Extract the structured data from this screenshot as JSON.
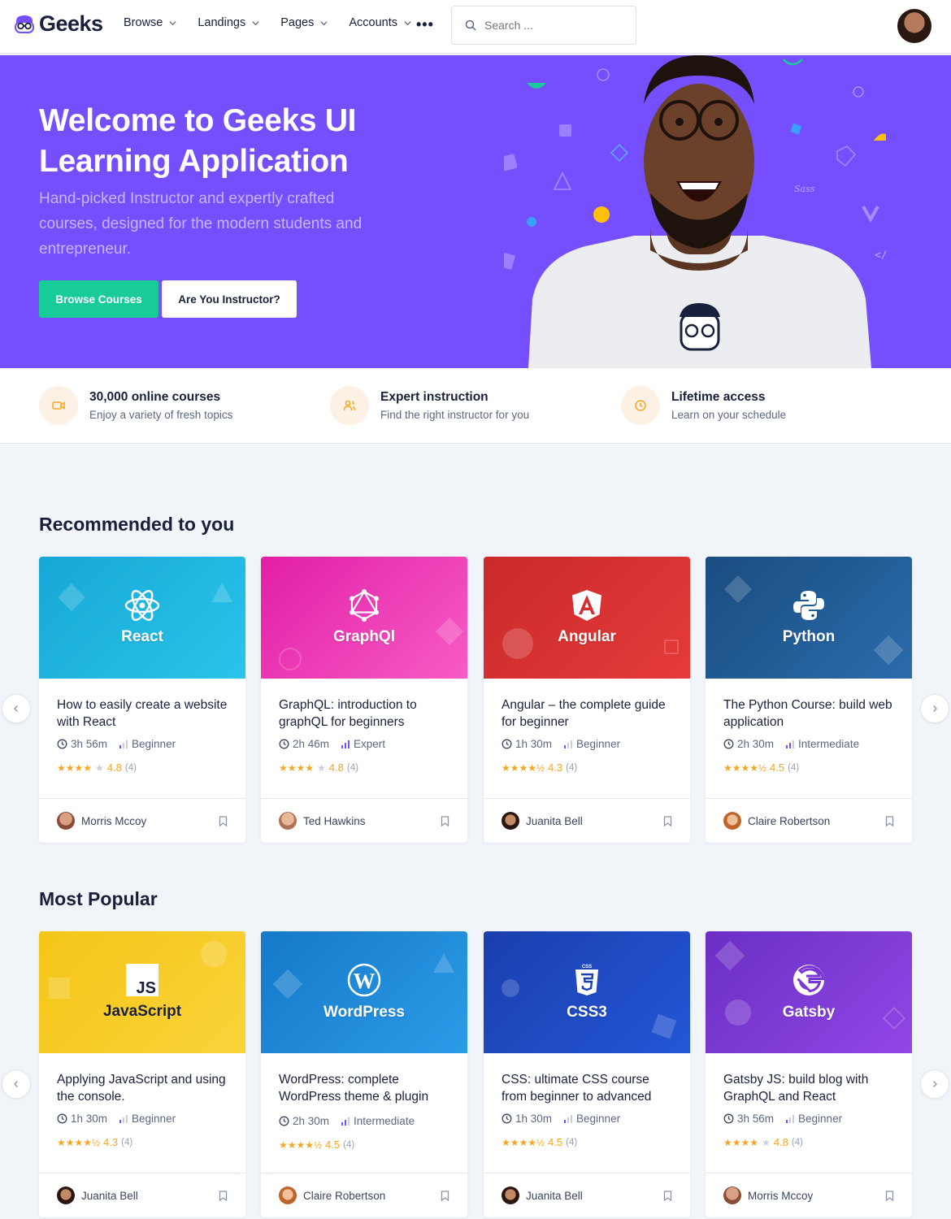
{
  "brand": {
    "name": "Geeks"
  },
  "nav": {
    "items": [
      {
        "label": "Browse"
      },
      {
        "label": "Landings"
      },
      {
        "label": "Pages"
      },
      {
        "label": "Accounts"
      }
    ],
    "more": "•••"
  },
  "search": {
    "placeholder": "Search ..."
  },
  "hero": {
    "title": "Welcome to Geeks UI Learning Application",
    "description": "Hand-picked Instructor and expertly crafted courses, designed for the modern students and entrepreneur.",
    "primary_button": "Browse Courses",
    "secondary_button": "Are You Instructor?"
  },
  "features": [
    {
      "title": "30,000 online courses",
      "subtitle": "Enjoy a variety of fresh topics",
      "icon": "video-icon"
    },
    {
      "title": "Expert instruction",
      "subtitle": "Find the right instructor for you",
      "icon": "users-icon"
    },
    {
      "title": "Lifetime access",
      "subtitle": "Learn on your schedule",
      "icon": "clock-icon"
    }
  ],
  "recommended": {
    "title": "Recommended to you",
    "courses": [
      {
        "thumb": "React",
        "title": "How to easily create a website with React",
        "duration": "3h 56m",
        "level": "Beginner",
        "rating": "4.8",
        "count": "(4)",
        "stars": "★★★★",
        "star_off": "★",
        "author": "Morris Mccoy"
      },
      {
        "thumb": "GraphQl",
        "title": "GraphQL: introduction to graphQL for beginners",
        "duration": "2h 46m",
        "level": "Expert",
        "rating": "4.8",
        "count": "(4)",
        "stars": "★★★★",
        "star_off": "★",
        "author": "Ted Hawkins"
      },
      {
        "thumb": "Angular",
        "title": "Angular – the complete guide for beginner",
        "duration": "1h 30m",
        "level": "Beginner",
        "rating": "4.3",
        "count": "(4)",
        "stars": "★★★★½",
        "star_off": "",
        "author": "Juanita Bell"
      },
      {
        "thumb": "Python",
        "title": "The Python Course: build web application",
        "duration": "2h 30m",
        "level": "Intermediate",
        "rating": "4.5",
        "count": "(4)",
        "stars": "★★★★½",
        "star_off": "",
        "author": "Claire Robertson"
      }
    ]
  },
  "popular": {
    "title": "Most Popular",
    "courses": [
      {
        "thumb": "JavaScript",
        "title": "Applying JavaScript and using the console.",
        "duration": "1h 30m",
        "level": "Beginner",
        "rating": "4.3",
        "count": "(4)",
        "stars": "★★★★½",
        "star_off": "",
        "author": "Juanita Bell"
      },
      {
        "thumb": "WordPress",
        "title": "WordPress: complete WordPress theme & plugin",
        "duration": "2h 30m",
        "level": "Intermediate",
        "rating": "4.5",
        "count": "(4)",
        "stars": "★★★★½",
        "star_off": "",
        "author": "Claire Robertson"
      },
      {
        "thumb": "CSS3",
        "title": "CSS: ultimate CSS course from beginner to advanced",
        "duration": "1h 30m",
        "level": "Beginner",
        "rating": "4.5",
        "count": "(4)",
        "stars": "★★★★½",
        "star_off": "",
        "author": "Juanita Bell"
      },
      {
        "thumb": "Gatsby",
        "title": "Gatsby JS: build blog with GraphQL and React",
        "duration": "3h 56m",
        "level": "Beginner",
        "rating": "4.8",
        "count": "(4)",
        "stars": "★★★★",
        "star_off": "",
        "author": "Morris Mccoy"
      }
    ]
  },
  "colors": {
    "primary": "#754ffe",
    "success": "#19cb98",
    "warning": "#f5a623"
  }
}
